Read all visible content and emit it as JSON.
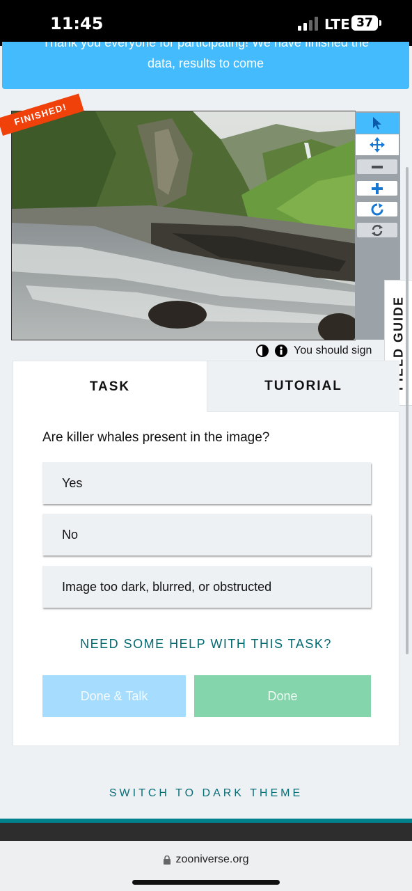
{
  "status_bar": {
    "time": "11:45",
    "network": "LTE",
    "battery": "37"
  },
  "announcement": {
    "line1": "Thank you everyone for participating! We have finished the",
    "line2": "data, results to come"
  },
  "subject": {
    "banner": "FINISHED!",
    "image_description_icon": "landscape-photo"
  },
  "toolbar": {
    "tools": [
      {
        "name": "pointer-icon",
        "active": true
      },
      {
        "name": "move-icon",
        "active": false
      },
      {
        "name": "zoom-out-icon",
        "disabled": true
      },
      {
        "name": "zoom-in-icon",
        "disabled": false
      },
      {
        "name": "rotate-icon",
        "disabled": false
      },
      {
        "name": "reset-icon",
        "disabled": true
      }
    ]
  },
  "meta": {
    "sign_in_text": "You should sign"
  },
  "field_guide": {
    "label": "FIELD GUIDE"
  },
  "tabs": {
    "task": "TASK",
    "tutorial": "TUTORIAL"
  },
  "task": {
    "question": "Are killer whales present in the image?",
    "answers": [
      "Yes",
      "No",
      "Image too dark, blurred, or obstructed"
    ],
    "help_link": "NEED SOME HELP WITH THIS TASK?",
    "done_talk_label": "Done & Talk",
    "done_label": "Done"
  },
  "theme": {
    "switch_label": "SWITCH TO DARK THEME"
  },
  "browser": {
    "url": "zooniverse.org"
  },
  "colors": {
    "accent_blue": "#43bbfd",
    "finished_orange": "#f0410b",
    "done_green": "#84d5ac",
    "teal_link": "#006a72"
  }
}
